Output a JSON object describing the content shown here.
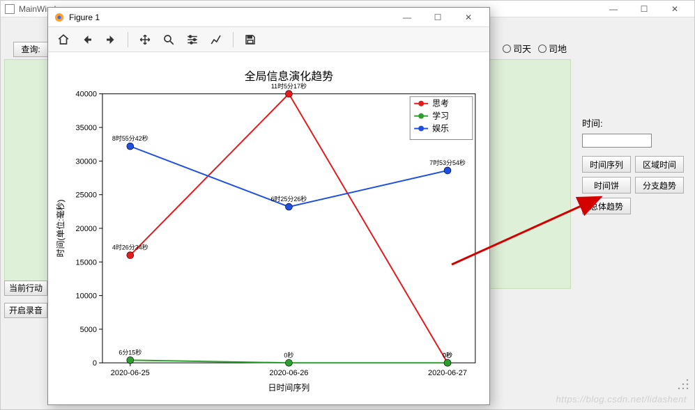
{
  "main_window": {
    "title": "MainWindow",
    "query_label": "查询:",
    "left_buttons": {
      "current": "当前行动",
      "record": "开启录音"
    },
    "radios": {
      "sitian": "司天",
      "sidi": "司地"
    }
  },
  "right_panel": {
    "time_label": "时间:",
    "time_value": "",
    "buttons": {
      "time_series": "时间序列",
      "area_time": "区域时间",
      "time_pie": "时间饼",
      "branch_trend": "分支趋势",
      "overall_trend": "总体趋势"
    }
  },
  "figure_window": {
    "title": "Figure 1"
  },
  "chart_data": {
    "type": "line",
    "title": "全局信息演化趋势",
    "xlabel": "日时间序列",
    "ylabel": "时间(单位:毫秒)",
    "categories": [
      "2020-06-25",
      "2020-06-26",
      "2020-06-27"
    ],
    "ylim": [
      0,
      40000
    ],
    "yticks": [
      0,
      5000,
      10000,
      15000,
      20000,
      25000,
      30000,
      35000,
      40000
    ],
    "legend_position": "top-right",
    "series": [
      {
        "name": "思考",
        "color": "#e41a1c",
        "values": [
          16000,
          40000,
          0
        ],
        "labels": [
          "4时26分34秒",
          "11时5分17秒",
          "0秒"
        ]
      },
      {
        "name": "学习",
        "color": "#2ca02c",
        "values": [
          400,
          0,
          0
        ],
        "labels": [
          "6分15秒",
          "0秒",
          "0秒"
        ]
      },
      {
        "name": "娱乐",
        "color": "#1f4fe0",
        "values": [
          32200,
          23200,
          28600
        ],
        "labels": [
          "8时55分42秒",
          "6时25分26秒",
          "7时53分54秒"
        ]
      }
    ]
  },
  "watermark": "https://blog.csdn.net/lidashent"
}
